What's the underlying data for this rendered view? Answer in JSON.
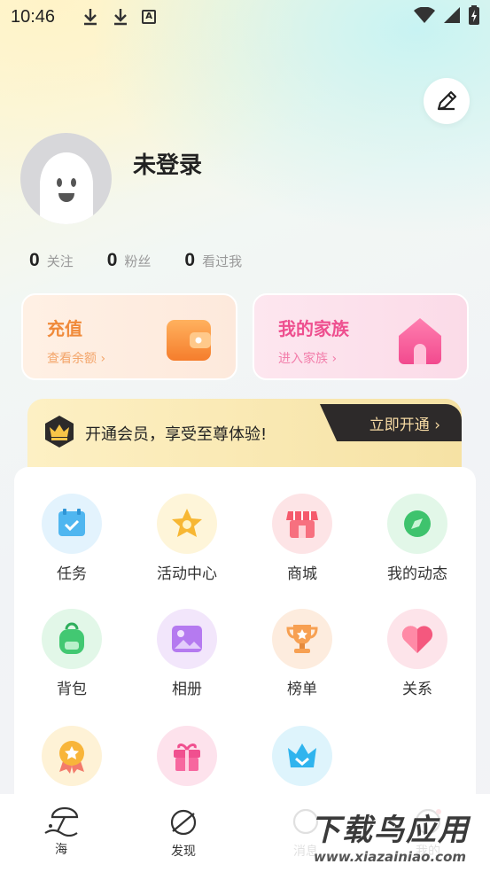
{
  "status_bar": {
    "time": "10:46",
    "text_icon": "A",
    "icons": [
      "download-icon",
      "download-icon",
      "text-icon",
      "wifi-icon",
      "signal-icon",
      "battery-icon"
    ]
  },
  "profile": {
    "username": "未登录"
  },
  "stats": [
    {
      "num": "0",
      "label": "关注"
    },
    {
      "num": "0",
      "label": "粉丝"
    },
    {
      "num": "0",
      "label": "看过我"
    }
  ],
  "cards": {
    "recharge": {
      "title": "充值",
      "sub": "查看余额 ›"
    },
    "family": {
      "title": "我的家族",
      "sub": "进入家族 ›"
    }
  },
  "vip": {
    "text": "开通会员，享受至尊体验!",
    "button": "立即开通 ›"
  },
  "grid": [
    {
      "label": "任务",
      "icon": "task-icon",
      "bg": "#e3f3fd"
    },
    {
      "label": "活动中心",
      "icon": "star-icon",
      "bg": "#fef5d9"
    },
    {
      "label": "商城",
      "icon": "shop-icon",
      "bg": "#fde4e6"
    },
    {
      "label": "我的动态",
      "icon": "compass-icon",
      "bg": "#e2f7e8"
    },
    {
      "label": "背包",
      "icon": "backpack-icon",
      "bg": "#e2f7e8"
    },
    {
      "label": "相册",
      "icon": "album-icon",
      "bg": "#f2e6fb"
    },
    {
      "label": "榜单",
      "icon": "trophy-icon",
      "bg": "#fdecde"
    },
    {
      "label": "关系",
      "icon": "heart-icon",
      "bg": "#fde4ea"
    },
    {
      "label": "",
      "icon": "medal-icon",
      "bg": "#fef2d6"
    },
    {
      "label": "",
      "icon": "gift-icon",
      "bg": "#fde2ec"
    },
    {
      "label": "",
      "icon": "crown-icon",
      "bg": "#def4fc"
    }
  ],
  "nav": [
    {
      "label": "海",
      "icon": "beach-icon"
    },
    {
      "label": "发现",
      "icon": "planet-icon"
    },
    {
      "label": "消息",
      "icon": "message-icon"
    },
    {
      "label": "我的",
      "icon": "profile-icon"
    }
  ],
  "watermark": {
    "big": "下载鸟应用",
    "small": "www.xiazainiao.com"
  }
}
